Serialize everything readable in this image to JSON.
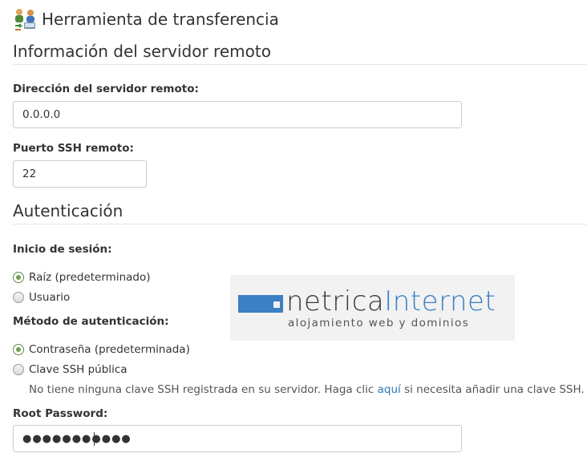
{
  "header": {
    "title": "Herramienta de transferencia",
    "icon": "transfer-tool-icon"
  },
  "remote_server": {
    "section_title": "Información del servidor remoto",
    "address_label": "Dirección del servidor remoto:",
    "address_value": "0.0.0.0",
    "ssh_port_label": "Puerto SSH remoto:",
    "ssh_port_value": "22"
  },
  "authentication": {
    "section_title": "Autenticación",
    "login_label": "Inicio de sesión:",
    "login_options": [
      {
        "label": "Raíz (predeterminado)",
        "checked": true
      },
      {
        "label": "Usuario",
        "checked": false
      }
    ],
    "method_label": "Método de autenticación:",
    "method_options": [
      {
        "label": "Contraseña (predeterminada)",
        "checked": true
      },
      {
        "label": "Clave SSH pública",
        "checked": false
      }
    ],
    "ssh_help_before": "No tiene ninguna clave SSH registrada en su servidor. Haga clic ",
    "ssh_help_link": "aquí",
    "ssh_help_after": " si necesita añadir una clave SSH.",
    "password_label": "Root Password:",
    "password_value": "●●●●●●●●●●●"
  },
  "logo": {
    "word_part1": "netrica",
    "word_part2": "Internet",
    "tagline": "alojamiento web y dominios"
  },
  "colors": {
    "accent": "#3b7fc4",
    "link": "#2a7ab5",
    "radio_checked": "#6f9e4f"
  }
}
